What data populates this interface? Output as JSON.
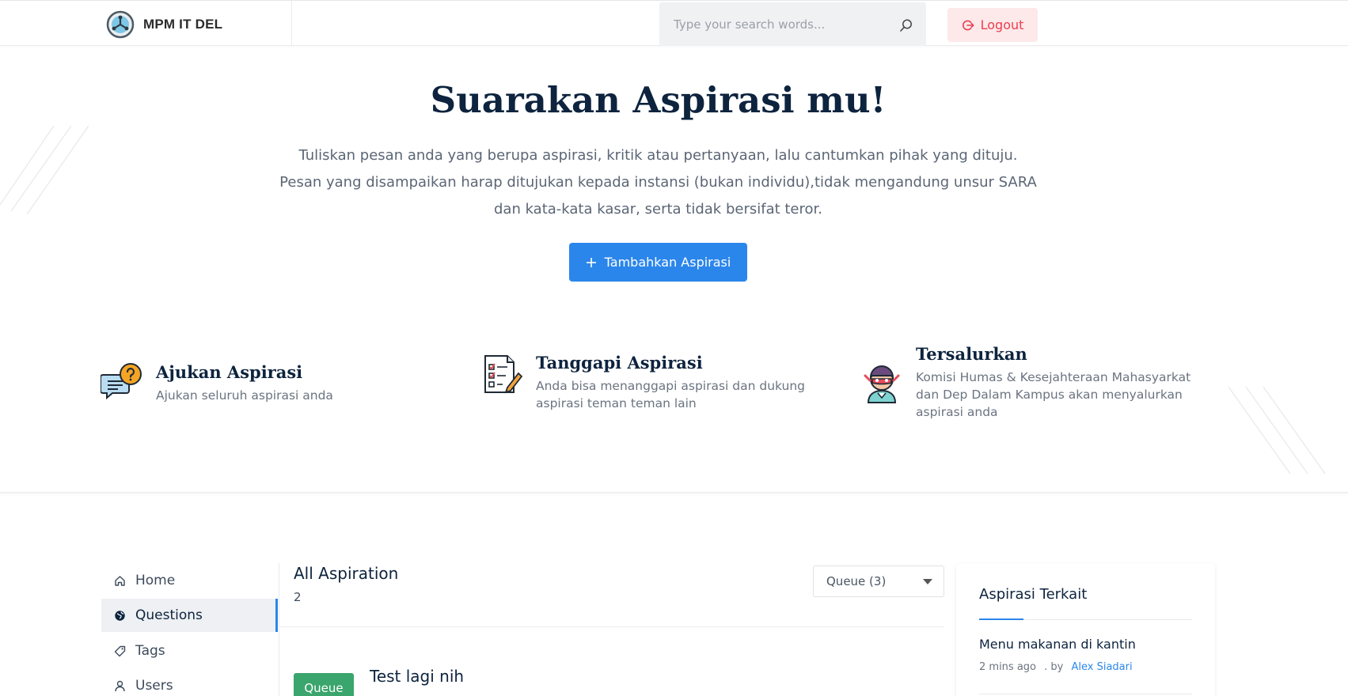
{
  "header": {
    "logo_text": "MPM IT DEL",
    "search_placeholder": "Type your search words...",
    "logout_label": "Logout"
  },
  "hero": {
    "title": "Suarakan Aspirasi mu!",
    "desc_line1": "Tuliskan pesan anda yang berupa aspirasi, kritik atau pertanyaan, lalu cantumkan pihak yang dituju.",
    "desc_line2": "Pesan yang disampaikan harap ditujukan kepada instansi (bukan individu),tidak mengandung unsur SARA",
    "desc_line3": "dan kata-kata kasar, serta tidak bersifat teror.",
    "button_label": "Tambahkan Aspirasi"
  },
  "features": [
    {
      "title": "Ajukan Aspirasi",
      "text": "Ajukan seluruh aspirasi anda",
      "icon": "chat-question-icon"
    },
    {
      "title": "Tanggapi Aspirasi",
      "text": "Anda bisa menanggapi aspirasi dan dukung aspirasi teman teman lain",
      "icon": "checklist-icon"
    },
    {
      "title": "Tersalurkan",
      "text": "Komisi Humas & Kesejahteraan Mahasyarkat dan Dep Dalam Kampus akan menyalurkan aspirasi anda",
      "icon": "hero-avatar-icon"
    }
  ],
  "sidebar": {
    "items": [
      {
        "label": "Home",
        "icon": "home-icon"
      },
      {
        "label": "Questions",
        "icon": "globe-icon",
        "active": true
      },
      {
        "label": "Tags",
        "icon": "tag-icon"
      },
      {
        "label": "Users",
        "icon": "user-icon"
      }
    ]
  },
  "main": {
    "title": "All Aspiration",
    "count": "2",
    "filter_value": "Queue (3)",
    "questions": [
      {
        "status": "Queue",
        "title": "Test lagi nih"
      }
    ]
  },
  "related": {
    "title": "Aspirasi Terkait",
    "items": [
      {
        "title": "Menu makanan di kantin",
        "time": "2 mins ago",
        "by": ". by",
        "author": "Alex Siadari"
      }
    ]
  },
  "colors": {
    "primary": "#2b86eb",
    "navy": "#0d233e",
    "queue_green": "#3aa56c",
    "logout_red": "#e9414f",
    "logout_bg": "#fde8ea"
  }
}
